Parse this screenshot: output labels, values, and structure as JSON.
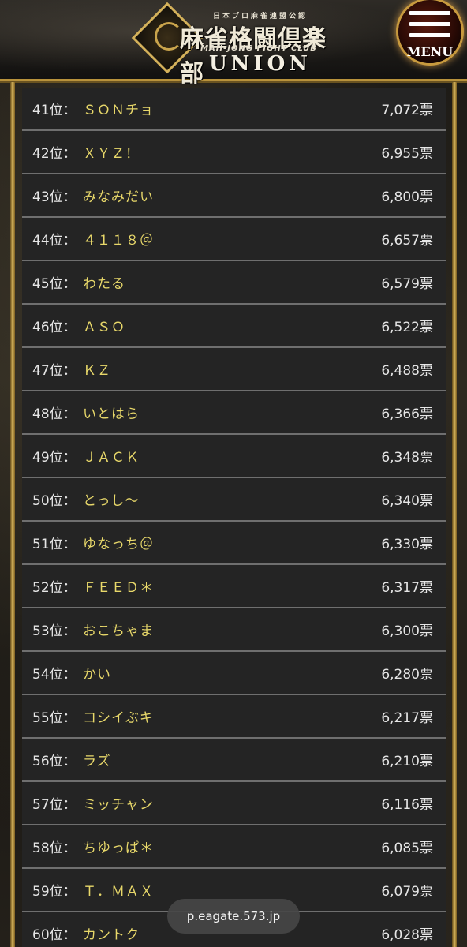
{
  "header": {
    "small_title": "日本プロ麻雀連盟公認",
    "main_title": "麻雀格闘倶楽部",
    "subtitle": "MAH-JONG FIGHT CLUB",
    "union": "UNION",
    "menu_label": "MENU",
    "logo_icon": "dragon-emblem-icon",
    "menu_icon": "hamburger-icon"
  },
  "colors": {
    "name": "#e8d86a",
    "rail": "#d9b75d",
    "row_bg": "#242424"
  },
  "rankings": [
    {
      "rank": "41位：",
      "name": "ＳＯＮチョ",
      "votes": "7,072票"
    },
    {
      "rank": "42位：",
      "name": "ＸＹＺ！",
      "votes": "6,955票"
    },
    {
      "rank": "43位：",
      "name": "みなみだい",
      "votes": "6,800票"
    },
    {
      "rank": "44位：",
      "name": "４１１８＠",
      "votes": "6,657票"
    },
    {
      "rank": "45位：",
      "name": "わたる",
      "votes": "6,579票"
    },
    {
      "rank": "46位：",
      "name": "ＡＳＯ",
      "votes": "6,522票"
    },
    {
      "rank": "47位：",
      "name": "ＫＺ",
      "votes": "6,488票"
    },
    {
      "rank": "48位：",
      "name": "いとはら",
      "votes": "6,366票"
    },
    {
      "rank": "49位：",
      "name": "ＪＡＣＫ",
      "votes": "6,348票"
    },
    {
      "rank": "50位：",
      "name": "とっし〜",
      "votes": "6,340票"
    },
    {
      "rank": "51位：",
      "name": "ゆなっち＠",
      "votes": "6,330票"
    },
    {
      "rank": "52位：",
      "name": "ＦＥＥＤ＊",
      "votes": "6,317票"
    },
    {
      "rank": "53位：",
      "name": "おこちゃま",
      "votes": "6,300票"
    },
    {
      "rank": "54位：",
      "name": "かい",
      "votes": "6,280票"
    },
    {
      "rank": "55位：",
      "name": "コシイぶキ",
      "votes": "6,217票"
    },
    {
      "rank": "56位：",
      "name": "ラズ",
      "votes": "6,210票"
    },
    {
      "rank": "57位：",
      "name": "ミッチャン",
      "votes": "6,116票"
    },
    {
      "rank": "58位：",
      "name": "ちゆっぱ＊",
      "votes": "6,085票"
    },
    {
      "rank": "59位：",
      "name": "Ｔ．ＭＡＸ",
      "votes": "6,079票"
    },
    {
      "rank": "60位：",
      "name": "カントク",
      "votes": "6,028票"
    }
  ],
  "url_bar": {
    "url": "p.eagate.573.jp"
  }
}
